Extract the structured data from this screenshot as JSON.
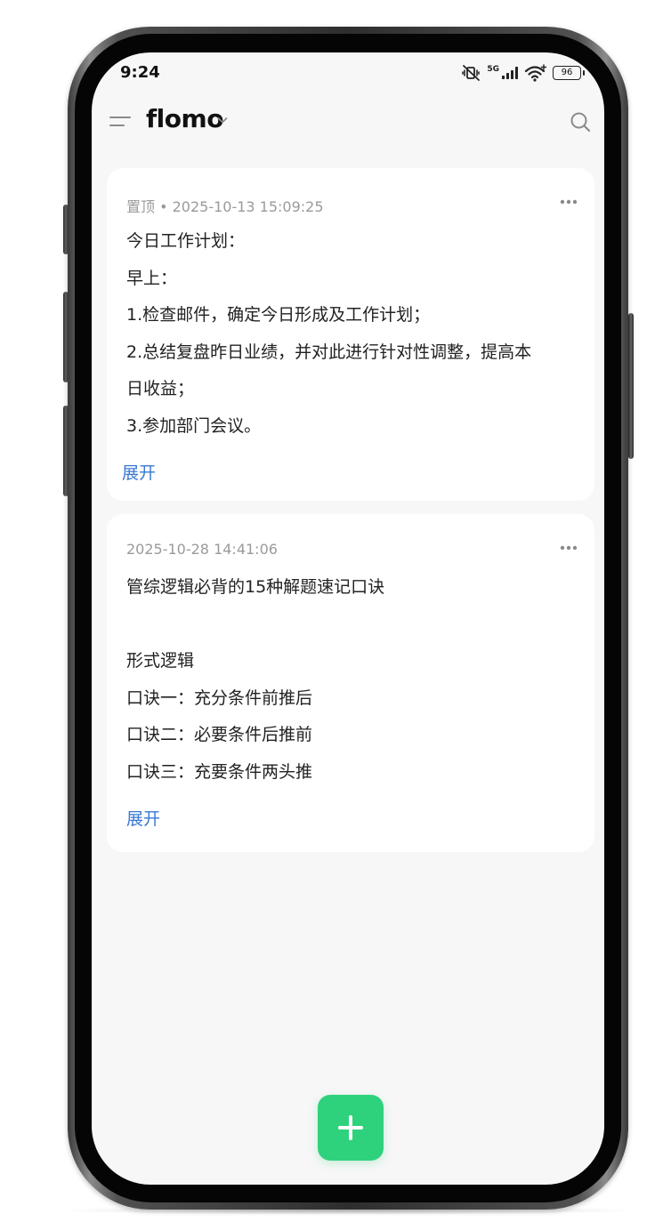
{
  "status_bar": {
    "time": "9:24",
    "network": "5G",
    "battery": "96",
    "icons": [
      "mute-vibrate-icon",
      "signal-icon",
      "wifi-icon",
      "battery-icon"
    ]
  },
  "header": {
    "app_title": "flomo",
    "icons": [
      "menu-icon",
      "chevron-down-icon",
      "search-icon"
    ]
  },
  "memos": [
    {
      "meta": "置顶 • 2025-10-13 15:09:25",
      "lines": [
        "今日工作计划：",
        "早上：",
        "1.检查邮件，确定今日形成及工作计划；",
        "2.总结复盘昨日业绩，并对此进行针对性调整，提高本",
        "日收益；",
        "3.参加部门会议。"
      ],
      "expand_label": "展开"
    },
    {
      "meta": "2025-10-28 14:41:06",
      "lines": [
        "管综逻辑必背的15种解题速记口诀",
        "",
        "形式逻辑",
        "口诀一：充分条件前推后",
        "口诀二：必要条件后推前",
        "口诀三：充要条件两头推"
      ],
      "expand_label": "展开"
    }
  ],
  "fab": {
    "icon": "plus-icon"
  },
  "colors": {
    "accent_green": "#2fd27c",
    "link_blue": "#3a78d4",
    "background": "#f7f7f7",
    "card": "#ffffff"
  }
}
